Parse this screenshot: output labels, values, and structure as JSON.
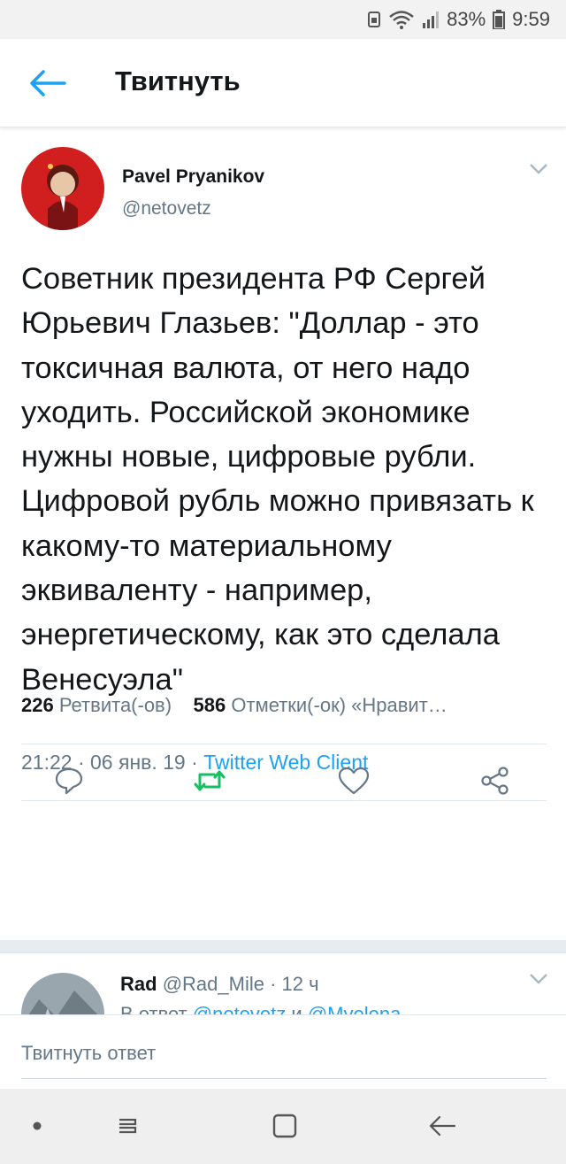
{
  "status_bar": {
    "battery": "83%",
    "time": "9:59",
    "icons": [
      "sim-icon",
      "wifi-icon",
      "signal-icon",
      "battery-icon"
    ]
  },
  "header": {
    "title": "Твитнуть",
    "back_icon": "arrow-left-icon"
  },
  "tweet": {
    "author_name": "Pavel Pryanikov",
    "author_handle": "@netovetz",
    "text": "Советник президента РФ Сергей Юрьевич Глазьев: \"Доллар - это токсичная валюта, от него надо уходить. Российской экономике нужны новые, цифровые рубли. Цифровой рубль можно привязать к какому-то материальному эквиваленту - например, энергетическому, как это сделала Венесуэла\"",
    "time": "21:22",
    "date": "06 янв. 19",
    "separator": " · ",
    "client": "Twitter Web Client",
    "retweets_count": "226",
    "retweets_label": "Ретвита(-ов)",
    "likes_count": "586",
    "likes_label": "Отметки(-ок) «Нравит…",
    "actions": [
      "reply-icon",
      "retweet-icon",
      "like-icon",
      "share-icon"
    ]
  },
  "reply": {
    "name": "Rad",
    "handle": "@Rad_Mile",
    "age": "· 12 ч",
    "in_reply_prefix": "В ответ",
    "mention1": "@netovetz",
    "conj": "и",
    "mention2": "@Myelena"
  },
  "compose": {
    "placeholder": "Твитнуть ответ"
  },
  "nav": {
    "buttons": [
      "dot-icon",
      "recents-icon",
      "home-icon",
      "back-icon"
    ]
  },
  "colors": {
    "accent": "#1da1f2",
    "retweet_green": "#17bf63",
    "text": "#14171a",
    "secondary": "#657786"
  }
}
